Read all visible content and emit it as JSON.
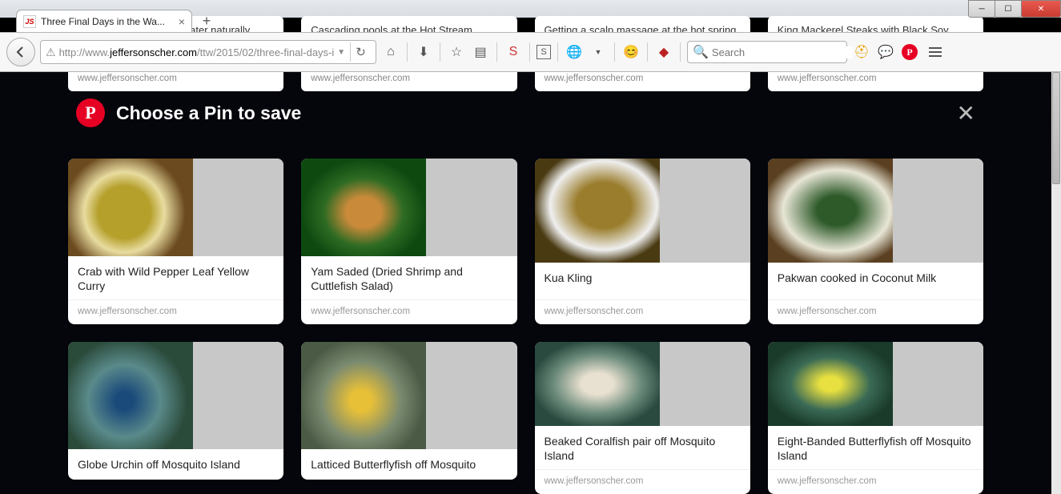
{
  "window": {
    "tab_title": "Three Final Days in the Wa...",
    "favicon_text": "JS"
  },
  "nav": {
    "url_domain": "jeffersonscher.com",
    "url_prefix": "http://www.",
    "url_path": "/ttw/2015/02/three-final-days-i",
    "search_placeholder": "Search"
  },
  "bg_cards": [
    {
      "title": "Hot Stream sign -- the water naturally springs up",
      "source": "www.jeffersonscher.com"
    },
    {
      "title": "Cascading pools at the Hot Stream Waterfall",
      "source": "www.jeffersonscher.com"
    },
    {
      "title": "Getting a scalp massage at the hot spring",
      "source": "www.jeffersonscher.com"
    },
    {
      "title": "King Mackerel Steaks with Black Soy Sauce",
      "source": "www.jeffersonscher.com"
    }
  ],
  "modal": {
    "title": "Choose a Pin to save"
  },
  "pins": [
    {
      "title": "Crab with Wild Pepper Leaf Yellow Curry",
      "source": "www.jeffersonscher.com",
      "cls": "curry"
    },
    {
      "title": "Yam Saded (Dried Shrimp and Cuttlefish Salad)",
      "source": "www.jeffersonscher.com",
      "cls": "salad"
    },
    {
      "title": "Kua Kling",
      "source": "www.jeffersonscher.com",
      "cls": "kua"
    },
    {
      "title": "Pakwan cooked in Coconut Milk",
      "source": "www.jeffersonscher.com",
      "cls": "pakwan"
    },
    {
      "title": "Globe Urchin off Mosquito Island",
      "source": "www.jeffersonscher.com",
      "cls": "urchin"
    },
    {
      "title": "Latticed Butterflyfish off Mosquito",
      "source": "www.jeffersonscher.com",
      "cls": "lattice"
    },
    {
      "title": "Beaked Coralfish pair off Mosquito Island",
      "source": "www.jeffersonscher.com",
      "cls": "beaked"
    },
    {
      "title": "Eight-Banded Butterflyfish off Mosquito Island",
      "source": "www.jeffersonscher.com",
      "cls": "eight"
    }
  ]
}
